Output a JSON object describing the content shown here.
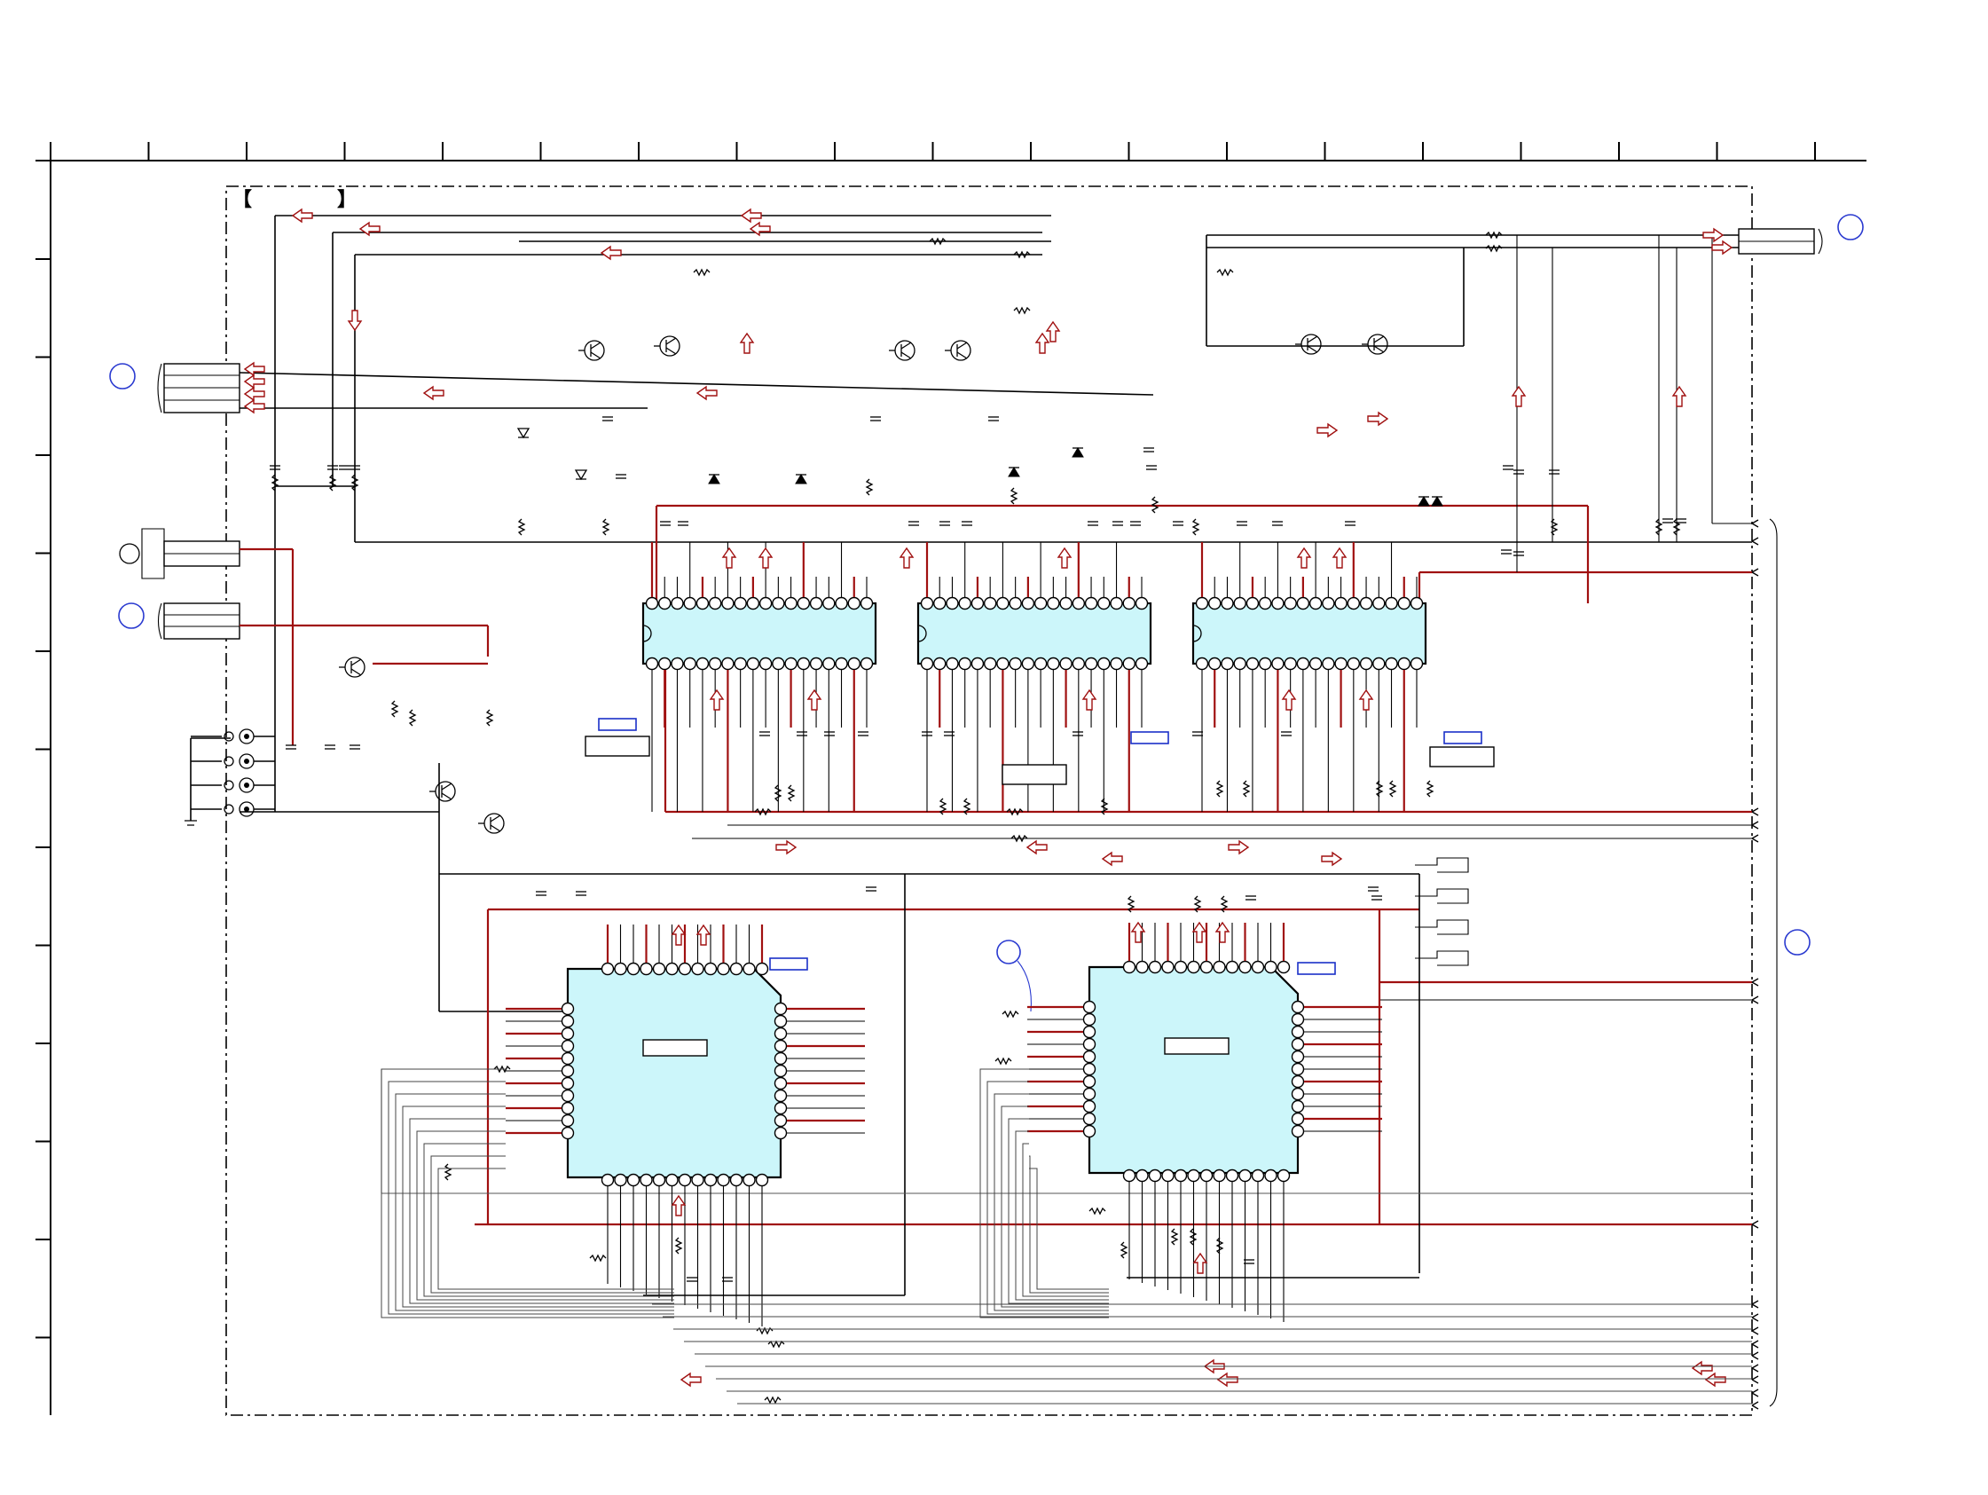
{
  "diagram": {
    "type": "circuit-schematic",
    "bracket_label_left": "【",
    "bracket_label_right": "】",
    "colors": {
      "ic_fill": "#ccf6fa",
      "signal_red": "#a01010",
      "ref_blue": "#2a3ad0",
      "wire": "#000000"
    },
    "icons": {
      "transistor": "transistor-icon",
      "diode": "diode-icon",
      "signal_arrow": "signal-arrow-icon",
      "ground": "ground-icon",
      "rca_jack": "rca-jack-icon"
    }
  }
}
